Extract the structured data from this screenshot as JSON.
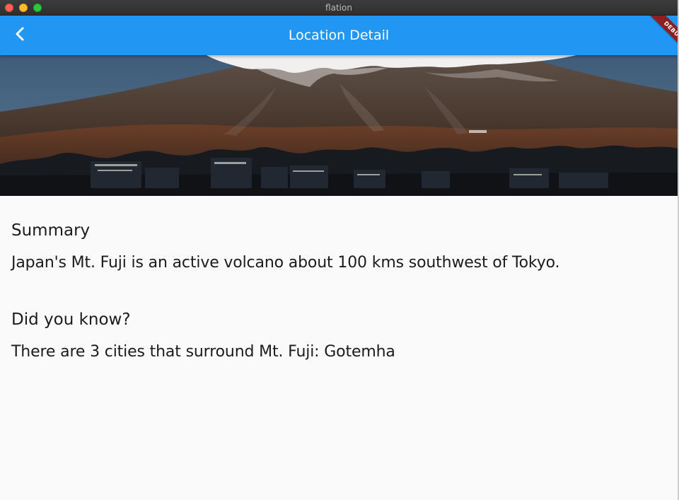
{
  "window": {
    "title": "flation"
  },
  "appbar": {
    "title": "Location Detail",
    "back_icon": "chevron-left-icon",
    "background": "#2196f3"
  },
  "debug_banner": {
    "label": "DEBUG",
    "color": "#8e1f1f"
  },
  "hero": {
    "image": "Mt. Fuji landscape photo",
    "snow_color": "#f4f1f0"
  },
  "content": {
    "summary_heading": "Summary",
    "summary_text": "Japan's Mt. Fuji is an active volcano about 100 kms southwest of Tokyo.",
    "did_you_know_heading": "Did you know?",
    "did_you_know_text": "There are 3 cities that surround Mt. Fuji: Gotemha"
  }
}
